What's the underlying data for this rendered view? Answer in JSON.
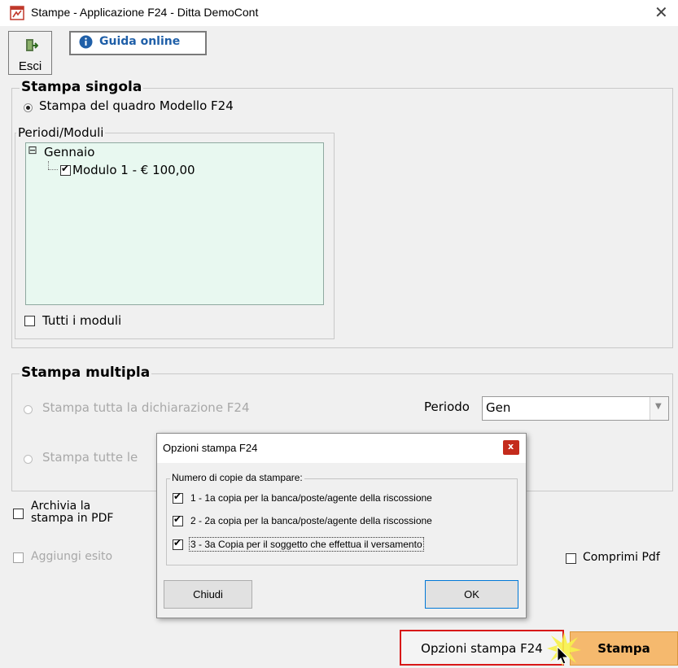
{
  "window": {
    "title": "Stampe - Applicazione F24 - Ditta DemoCont",
    "close_glyph": "✕"
  },
  "toolbar": {
    "esci_label": "Esci",
    "guida_label": "Guida online"
  },
  "stampa_singola": {
    "title": "Stampa singola",
    "radio_label": "Stampa del quadro Modello F24",
    "periodi_legend": "Periodi/Moduli",
    "tree": {
      "expander": "⊟",
      "month": "Gennaio",
      "module_label": "Modulo 1 - € 100,00",
      "module_checked": true
    },
    "tutti_moduli_label": "Tutti i moduli",
    "tutti_moduli_checked": false
  },
  "stampa_multipla": {
    "title": "Stampa multipla",
    "radio1_label": "Stampa tutta la dichiarazione F24",
    "radio2_label": "Stampa tutte le",
    "periodo_label": "Periodo",
    "periodo_value": "Gen"
  },
  "options": {
    "archivia_label": "Archivia la\nstampa in PDF",
    "aggiungi_label": "Aggiungi esito",
    "comprimi_label": "Comprimi Pdf"
  },
  "buttons": {
    "opzioni_label": "Opzioni stampa F24",
    "stampa_label": "Stampa"
  },
  "dialog": {
    "title": "Opzioni stampa F24",
    "close_glyph": "x",
    "group_legend": "Numero di copie da stampare:",
    "copies": [
      {
        "label": "1 - 1a copia per la banca/poste/agente della riscossione",
        "checked": true
      },
      {
        "label": "2 - 2a copia per la banca/poste/agente della riscossione",
        "checked": true
      },
      {
        "label": "3 - 3a Copia per il soggetto che effettua il versamento",
        "checked": true
      }
    ],
    "chiudi_label": "Chiudi",
    "ok_label": "OK"
  },
  "colors": {
    "tree_background": "#e8f8f0",
    "stampa_button": "#f5b96e",
    "highlight_border": "#d81818",
    "link_blue": "#1f5fa8",
    "dialog_close": "#c42b1c"
  }
}
